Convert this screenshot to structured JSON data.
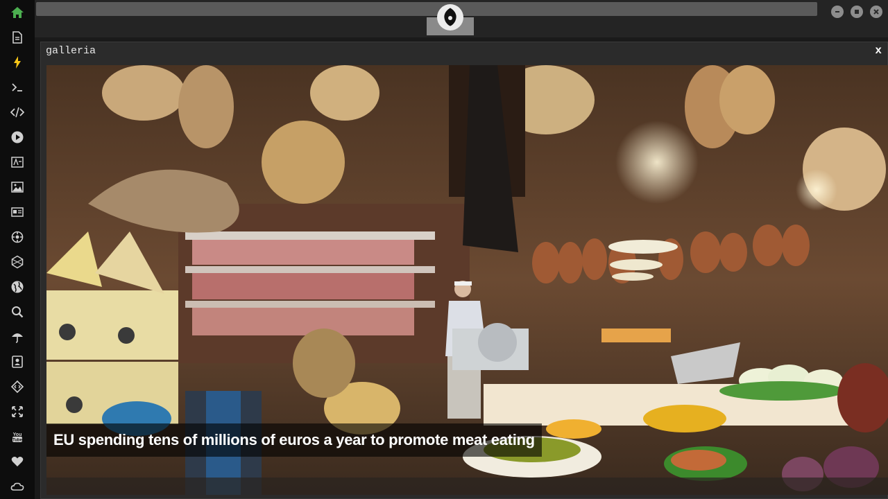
{
  "sidebar": {
    "icons": [
      "home-icon",
      "document-icon",
      "lightning-icon",
      "terminal-icon",
      "code-icon",
      "play-icon",
      "translate-icon",
      "image-icon",
      "news-icon",
      "settings-icon",
      "hexagon-icon",
      "globe-icon",
      "search-icon",
      "umbrella-icon",
      "contact-icon",
      "code-diamond-icon",
      "fullscreen-icon",
      "youtube-icon",
      "heart-icon",
      "cloud-icon"
    ],
    "accent": "#4caf50"
  },
  "topbar": {
    "logo": "rebel-alliance-logo"
  },
  "window": {
    "title": "galleria",
    "close_label": "x"
  },
  "gallery": {
    "caption": "EU spending tens of millions of euros a year to promote meat eating"
  }
}
